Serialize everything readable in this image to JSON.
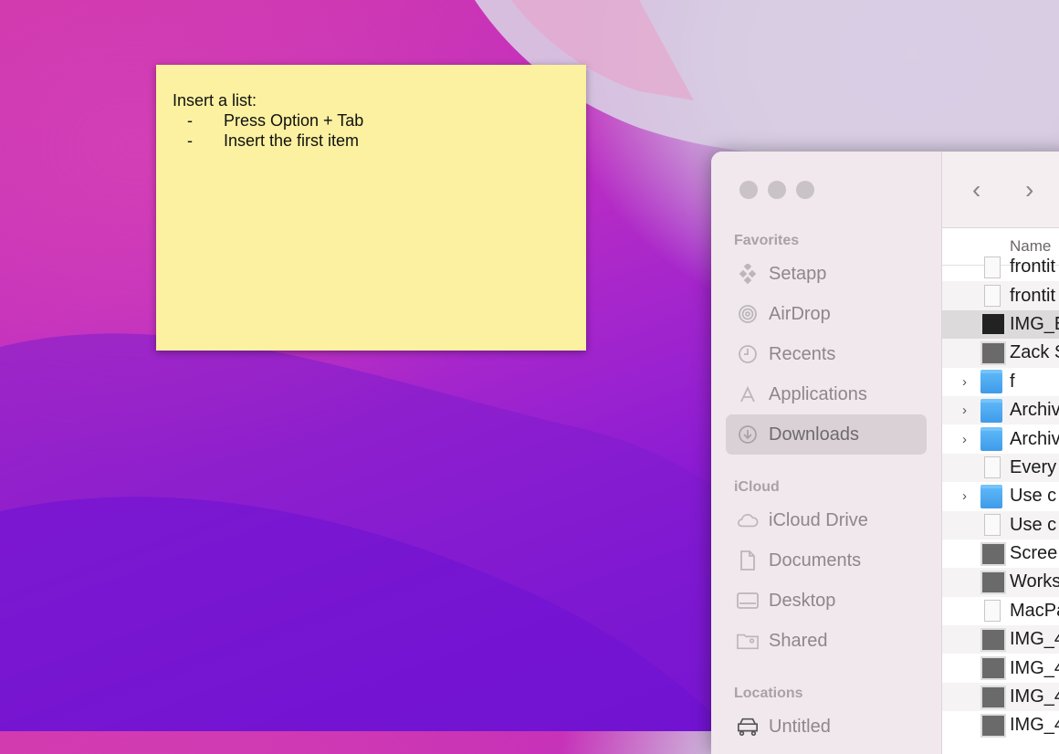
{
  "sticky_note": {
    "heading": "Insert a list:",
    "items": [
      {
        "bullet": "-",
        "text": "Press Option + Tab"
      },
      {
        "bullet": "-",
        "text": "Insert the first item"
      }
    ]
  },
  "finder": {
    "sidebar": {
      "favorites_label": "Favorites",
      "favorites": [
        {
          "label": "Setapp",
          "icon": "setapp-icon"
        },
        {
          "label": "AirDrop",
          "icon": "airdrop-icon"
        },
        {
          "label": "Recents",
          "icon": "clock-icon"
        },
        {
          "label": "Applications",
          "icon": "applications-icon"
        },
        {
          "label": "Downloads",
          "icon": "download-icon",
          "selected": true
        }
      ],
      "icloud_label": "iCloud",
      "icloud": [
        {
          "label": "iCloud Drive",
          "icon": "cloud-icon"
        },
        {
          "label": "Documents",
          "icon": "document-icon"
        },
        {
          "label": "Desktop",
          "icon": "desktop-icon"
        },
        {
          "label": "Shared",
          "icon": "shared-folder-icon"
        }
      ],
      "locations_label": "Locations",
      "locations": [
        {
          "label": "Untitled",
          "icon": "drive-icon"
        }
      ]
    },
    "toolbar": {
      "back": "‹",
      "forward": "›"
    },
    "column_header": "Name",
    "rows": [
      {
        "name": "frontit",
        "type": "doc",
        "disclosure": false
      },
      {
        "name": "frontit",
        "type": "doc",
        "disclosure": false
      },
      {
        "name": "IMG_E",
        "type": "dark",
        "disclosure": false,
        "selected": true
      },
      {
        "name": "Zack S",
        "type": "img",
        "disclosure": false
      },
      {
        "name": "f",
        "type": "folder",
        "disclosure": true
      },
      {
        "name": "Archiv",
        "type": "folder",
        "disclosure": true
      },
      {
        "name": "Archiv",
        "type": "folder",
        "disclosure": true
      },
      {
        "name": "Every",
        "type": "doc",
        "disclosure": false
      },
      {
        "name": "Use c",
        "type": "folder",
        "disclosure": true
      },
      {
        "name": "Use c",
        "type": "doc",
        "disclosure": false
      },
      {
        "name": "Scree",
        "type": "img",
        "disclosure": false
      },
      {
        "name": "Works",
        "type": "img",
        "disclosure": false
      },
      {
        "name": "MacPa",
        "type": "doc",
        "disclosure": false
      },
      {
        "name": "IMG_4",
        "type": "img",
        "disclosure": false
      },
      {
        "name": "IMG_4",
        "type": "img",
        "disclosure": false
      },
      {
        "name": "IMG_4",
        "type": "img",
        "disclosure": false
      },
      {
        "name": "IMG_4",
        "type": "img",
        "disclosure": false
      }
    ]
  }
}
